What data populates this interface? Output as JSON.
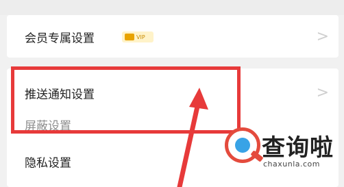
{
  "settings": {
    "member_row": {
      "label": "会员专属设置",
      "badge_text": "VIP",
      "chevron": ">"
    },
    "push_row": {
      "label": "推送通知设置",
      "chevron": ">"
    },
    "block_row": {
      "label": "屏蔽设置"
    },
    "privacy_row": {
      "label": "隐私设置"
    }
  },
  "watermark": {
    "title": "查询啦",
    "domain": "chaxunla.com",
    "icon": "search-magnifier-icon"
  },
  "annotation": {
    "highlight_color": "#e73a3a",
    "arrow_color": "#e73a3a"
  }
}
